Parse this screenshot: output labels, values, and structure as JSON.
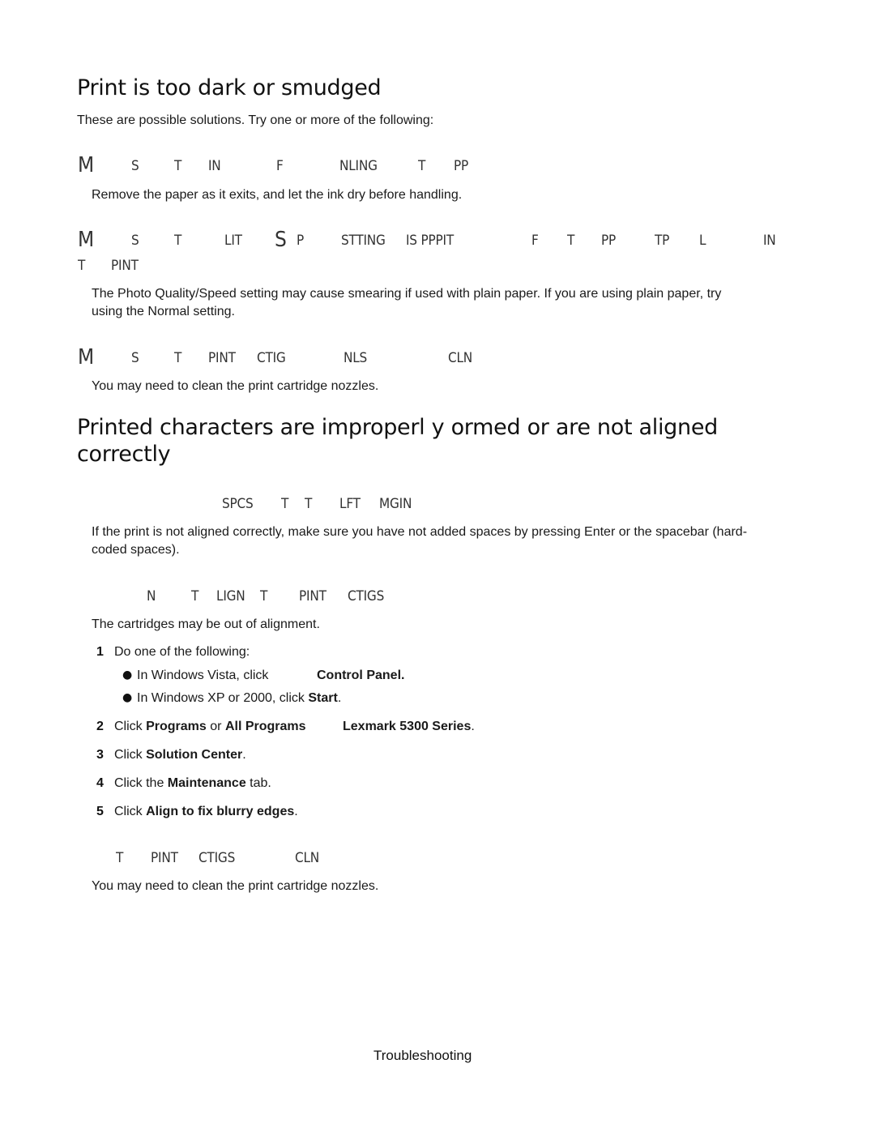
{
  "section1": {
    "title": "Print is too dark or smudged",
    "intro": "These are possible solutions. Try one or more of the following:",
    "solutions": [
      {
        "heading_fragments": [
          "M",
          "S",
          "T",
          "IN",
          "F",
          "NLING",
          "T",
          "PP"
        ],
        "text": "Remove the paper as it exits, and let the ink dry before handling."
      },
      {
        "heading_fragments": [
          "M",
          "S",
          "T",
          "LIT",
          "S",
          "P",
          "STTING",
          "IS PPPIT",
          "F",
          "T",
          "PP",
          "TP",
          "L",
          "IN",
          "T",
          "PINT"
        ],
        "text_line1": "The Photo Quality/Speed setting may cause smearing if used with plain paper. If you are using plain paper, try",
        "text_line2": "using the Normal setting."
      },
      {
        "heading_fragments": [
          "M",
          "S",
          "T",
          "PINT",
          "CTIG",
          "NLS",
          "CLN"
        ],
        "text": "You may need to clean the print cartridge nozzles."
      }
    ]
  },
  "section2": {
    "title_line1": "Printed characters are improperl y ormed or are not aligned",
    "title_line2": "correctly",
    "solutions": [
      {
        "heading_fragments": [
          "SPCS",
          "T",
          "T",
          "LFT",
          "MGIN"
        ],
        "text_line1": "If the print is not aligned correctly, make sure you have not added spaces by pressing Enter or the spacebar (hard-",
        "text_line2": "coded spaces)."
      },
      {
        "heading_fragments": [
          "N",
          "T",
          "LIGN",
          "T",
          "PINT",
          "CTIGS"
        ],
        "text": "The cartridges may be out of alignment.",
        "steps": [
          {
            "num": "1",
            "text": "Do one of the following:",
            "bullets": [
              {
                "pre": "In Windows Vista, click",
                "bold": "Control Panel."
              },
              {
                "pre": "In Windows XP or 2000, click ",
                "bold": "Start",
                "post": "."
              }
            ]
          },
          {
            "num": "2",
            "pre": "Click ",
            "bold1": "Programs",
            "mid": " or ",
            "bold2": "All Programs",
            "bold3": "Lexmark 5300 Series",
            "post": "."
          },
          {
            "num": "3",
            "pre": "Click ",
            "bold": "Solution Center",
            "post": "."
          },
          {
            "num": "4",
            "pre": "Click the ",
            "bold": "Maintenance",
            "post": " tab."
          },
          {
            "num": "5",
            "pre": "Click ",
            "bold": "Align to fix blurry edges",
            "post": "."
          }
        ]
      },
      {
        "heading_fragments": [
          "T",
          "PINT",
          "CTIGS",
          "CLN"
        ],
        "text": "You may need to clean the print cartridge nozzles."
      }
    ]
  },
  "footer": {
    "label": "Troubleshooting"
  }
}
